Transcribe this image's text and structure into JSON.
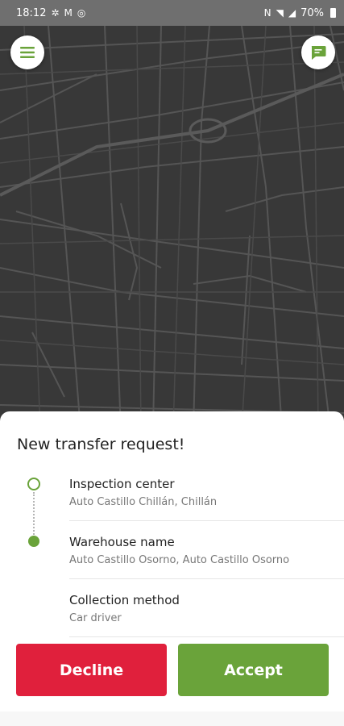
{
  "status_bar": {
    "time": "18:12",
    "battery": "70%"
  },
  "map": {
    "menu_icon": "hamburger-menu-icon",
    "chat_icon": "chat-message-icon",
    "accent": "#6aa33a"
  },
  "request": {
    "title": "New transfer request!",
    "items": [
      {
        "label": "Inspection center",
        "value": "Auto Castillo Chillán, Chillán"
      },
      {
        "label": "Warehouse name",
        "value": "Auto Castillo Osorno, Auto Castillo Osorno"
      },
      {
        "label": "Collection method",
        "value": "Car driver"
      }
    ]
  },
  "actions": {
    "decline_label": "Decline",
    "decline_color": "#e0203c",
    "accept_label": "Accept",
    "accept_color": "#6aa33a"
  }
}
